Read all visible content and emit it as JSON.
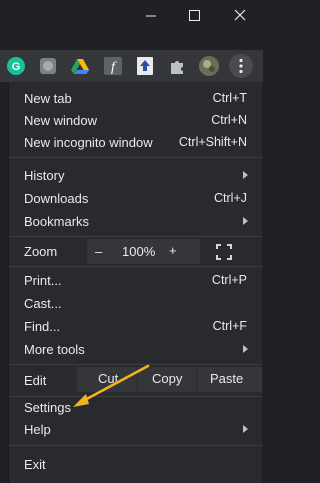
{
  "window_controls": {
    "minimize": "minimize",
    "maximize": "maximize",
    "close": "close"
  },
  "toolbar": {
    "extensions": [
      {
        "icon": "grammarly-icon",
        "color": "#15c39a"
      },
      {
        "icon": "gray-extension-icon",
        "color": "#9aa0a6"
      },
      {
        "icon": "google-drive-icon",
        "color": "#fbbc04"
      },
      {
        "icon": "script-extension-icon",
        "color": "#e8eaed"
      },
      {
        "icon": "upload-extension-icon",
        "color": "#4a7bd0"
      },
      {
        "icon": "puzzle-icon",
        "color": "#bdc1c6"
      },
      {
        "icon": "profile-avatar",
        "color": "#8a8f6e"
      },
      {
        "icon": "more-vert-icon",
        "color": "#e8eaed"
      }
    ]
  },
  "menu": {
    "group1": [
      {
        "label": "New tab",
        "shortcut": "Ctrl+T"
      },
      {
        "label": "New window",
        "shortcut": "Ctrl+N"
      },
      {
        "label": "New incognito window",
        "shortcut": "Ctrl+Shift+N"
      }
    ],
    "group2": [
      {
        "label": "History",
        "submenu": true
      },
      {
        "label": "Downloads",
        "shortcut": "Ctrl+J"
      },
      {
        "label": "Bookmarks",
        "submenu": true
      }
    ],
    "zoom": {
      "label": "Zoom",
      "minus": "–",
      "level": "100%",
      "plus": "+"
    },
    "group3": [
      {
        "label": "Print...",
        "shortcut": "Ctrl+P"
      },
      {
        "label": "Cast..."
      },
      {
        "label": "Find...",
        "shortcut": "Ctrl+F"
      },
      {
        "label": "More tools",
        "submenu": true
      }
    ],
    "edit": {
      "label": "Edit",
      "cut": "Cut",
      "copy": "Copy",
      "paste": "Paste"
    },
    "group4": [
      {
        "label": "Settings"
      },
      {
        "label": "Help",
        "submenu": true
      }
    ],
    "exit": "Exit"
  },
  "annotation": {
    "arrow_color": "#f2b51f"
  }
}
